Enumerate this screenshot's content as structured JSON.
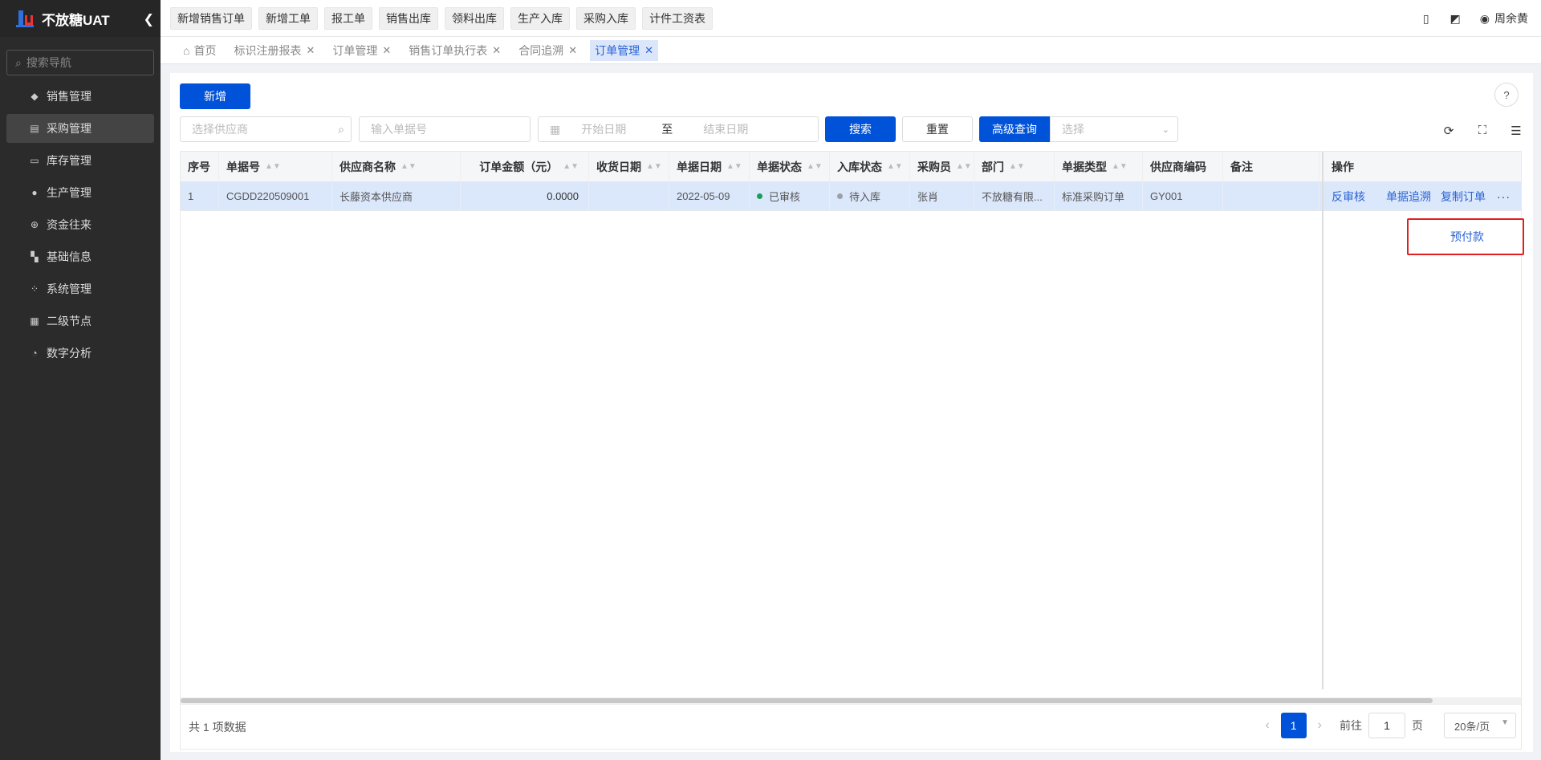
{
  "app": {
    "title": "不放糖UAT"
  },
  "sidebar": {
    "search_placeholder": "搜索导航",
    "items": [
      {
        "label": "销售管理",
        "icon": "tag-icon"
      },
      {
        "label": "采购管理",
        "icon": "cart-icon"
      },
      {
        "label": "库存管理",
        "icon": "inventory-icon"
      },
      {
        "label": "生产管理",
        "icon": "production-icon"
      },
      {
        "label": "资金往来",
        "icon": "funds-icon"
      },
      {
        "label": "基础信息",
        "icon": "info-icon"
      },
      {
        "label": "系统管理",
        "icon": "system-icon"
      },
      {
        "label": "二级节点",
        "icon": "node-icon"
      },
      {
        "label": "数字分析",
        "icon": "pie-chart-icon"
      }
    ]
  },
  "topbar": {
    "quick_buttons": [
      "新增销售订单",
      "新增工单",
      "报工单",
      "销售出库",
      "领料出库",
      "生产入库",
      "采购入库",
      "计件工资表"
    ],
    "user": "周余黄"
  },
  "tabs": [
    {
      "label": "首页"
    },
    {
      "label": "标识注册报表"
    },
    {
      "label": "订单管理"
    },
    {
      "label": "销售订单执行表"
    },
    {
      "label": "合同追溯"
    },
    {
      "label": "订单管理"
    }
  ],
  "toolbar": {
    "add": "新增",
    "supplier_placeholder": "选择供应商",
    "order_no_placeholder": "输入单据号",
    "start_date": "开始日期",
    "to": "至",
    "end_date": "结束日期",
    "search": "搜索",
    "reset": "重置",
    "advanced": "高级查询",
    "select_placeholder": "选择"
  },
  "table": {
    "headers": [
      "序号",
      "单据号",
      "供应商名称",
      "订单金额（元）",
      "收货日期",
      "单据日期",
      "单据状态",
      "入库状态",
      "采购员",
      "部门",
      "单据类型",
      "供应商编码",
      "备注"
    ],
    "op_header": "操作",
    "rows": [
      [
        "1",
        "CGDD220509001",
        "长藤资本供应商",
        "0.0000",
        "",
        "2022-05-09",
        "已审核",
        "待入库",
        "张肖",
        "不放糖有限...",
        "标准采购订单",
        "GY001",
        ""
      ]
    ],
    "ops": [
      "反审核",
      "单据追溯",
      "复制订单"
    ],
    "more": "···",
    "dropdown_item": "预付款"
  },
  "footer": {
    "total": "共 1 项数据",
    "page": "1",
    "goto_label": "前往",
    "goto_value": "1",
    "page_unit": "页",
    "page_size": "20条/页"
  },
  "colors": {
    "primary": "#0052d9",
    "approved": "#18a058",
    "pending": "#9aa0a6",
    "highlight": "#e02020"
  }
}
